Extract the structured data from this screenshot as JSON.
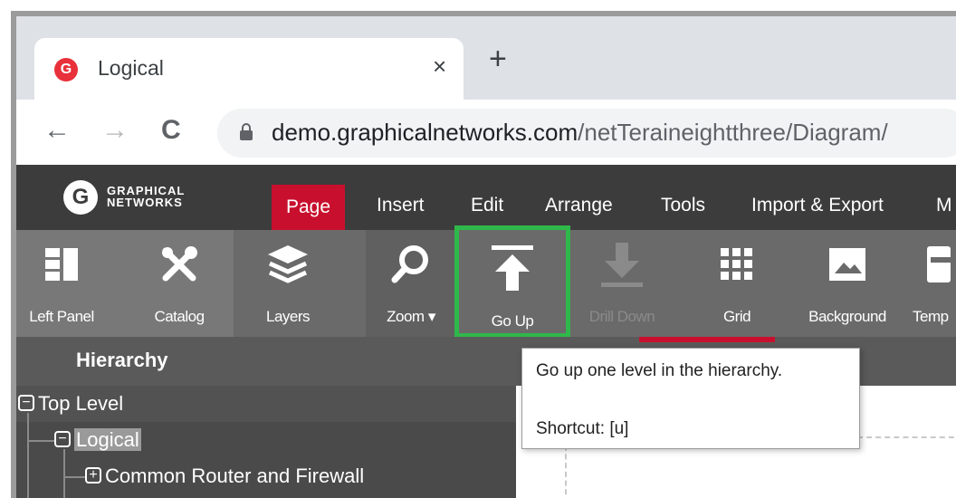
{
  "browser": {
    "tab_title": "Logical",
    "tab_close": "×",
    "new_tab": "+",
    "favicon_letter": "G",
    "back": "←",
    "forward": "→",
    "reload": "C",
    "url_host": "demo.graphicalnetworks.com",
    "url_path": "/netTeraineightthree/Diagram/"
  },
  "brand": {
    "logo_letter": "G",
    "line1": "GRAPHICAL",
    "line2": "NETWORKS"
  },
  "menu": {
    "items": [
      {
        "label": "Page",
        "active": true
      },
      {
        "label": "Insert"
      },
      {
        "label": "Edit"
      },
      {
        "label": "Arrange"
      },
      {
        "label": "Tools"
      },
      {
        "label": "Import & Export"
      },
      {
        "label": "M"
      }
    ]
  },
  "ribbon": {
    "left_panel": "Left Panel",
    "catalog": "Catalog",
    "layers": "Layers",
    "zoom": "Zoom ▾",
    "go_up": "Go Up",
    "drill_down": "Drill Down",
    "grid": "Grid",
    "background": "Background",
    "templates": "Temp"
  },
  "hierarchy": {
    "title": "Hierarchy",
    "items": [
      {
        "label": "Top Level",
        "toggle": "−"
      },
      {
        "label": "Logical",
        "toggle": "−",
        "selected": true
      },
      {
        "label": "Common Router and Firewall",
        "toggle": "+"
      }
    ]
  },
  "tooltip": {
    "text": "Go up one level in the hierarchy.",
    "shortcut": "Shortcut: [u]"
  },
  "colors": {
    "accent_red": "#c8102e",
    "highlight_green": "#2fb84a",
    "menubar": "#3c3c3c",
    "ribbon": "#6a6a6a"
  }
}
